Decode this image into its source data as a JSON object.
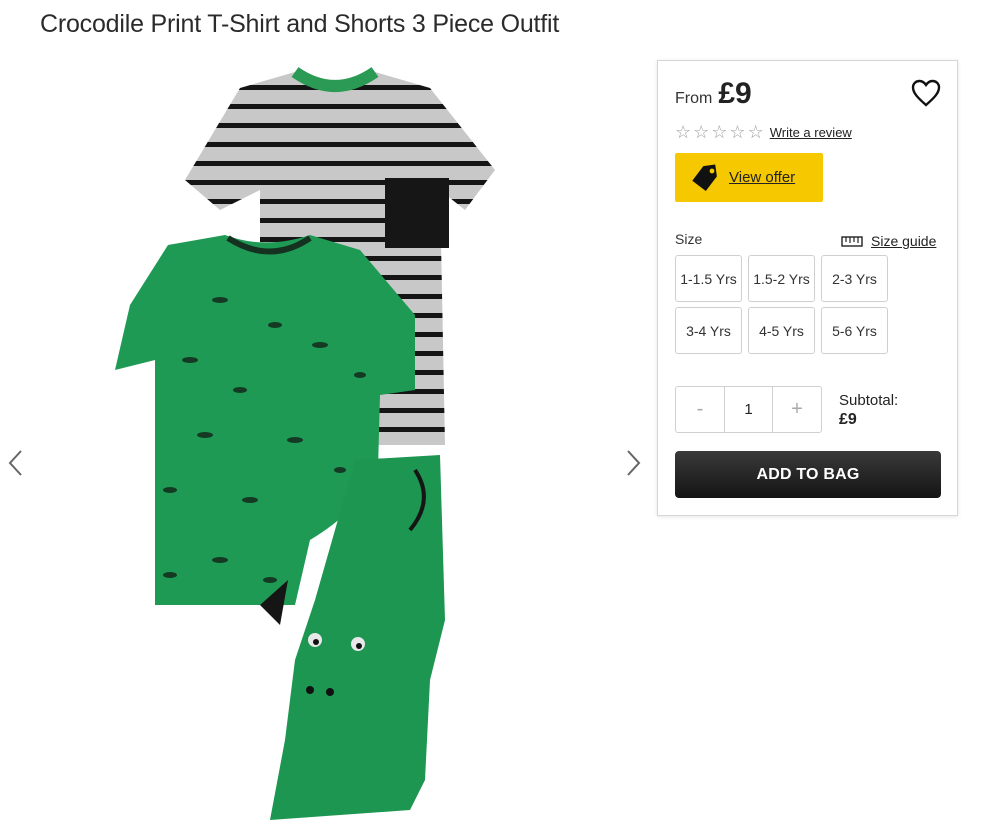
{
  "product": {
    "title": "Crocodile Print T-Shirt and Shorts 3 Piece Outfit"
  },
  "gallery": {
    "prev_icon": "chevron-left-icon",
    "next_icon": "chevron-right-icon"
  },
  "purchase": {
    "from_label": "From",
    "price": "£9",
    "wishlist_icon": "heart-icon",
    "rating_value": 0,
    "rating_max": 5,
    "review_link": "Write a review",
    "offer_label": "View offer",
    "offer_color": "#f5c800",
    "size_label": "Size",
    "size_guide_label": "Size guide",
    "sizes": [
      "1-1.5 Yrs",
      "1.5-2 Yrs",
      "2-3 Yrs",
      "3-4 Yrs",
      "4-5 Yrs",
      "5-6 Yrs"
    ],
    "qty_minus": "-",
    "quantity": "1",
    "qty_plus": "+",
    "subtotal_label": "Subtotal:",
    "subtotal_value": "£9",
    "add_to_bag": "ADD TO BAG"
  }
}
